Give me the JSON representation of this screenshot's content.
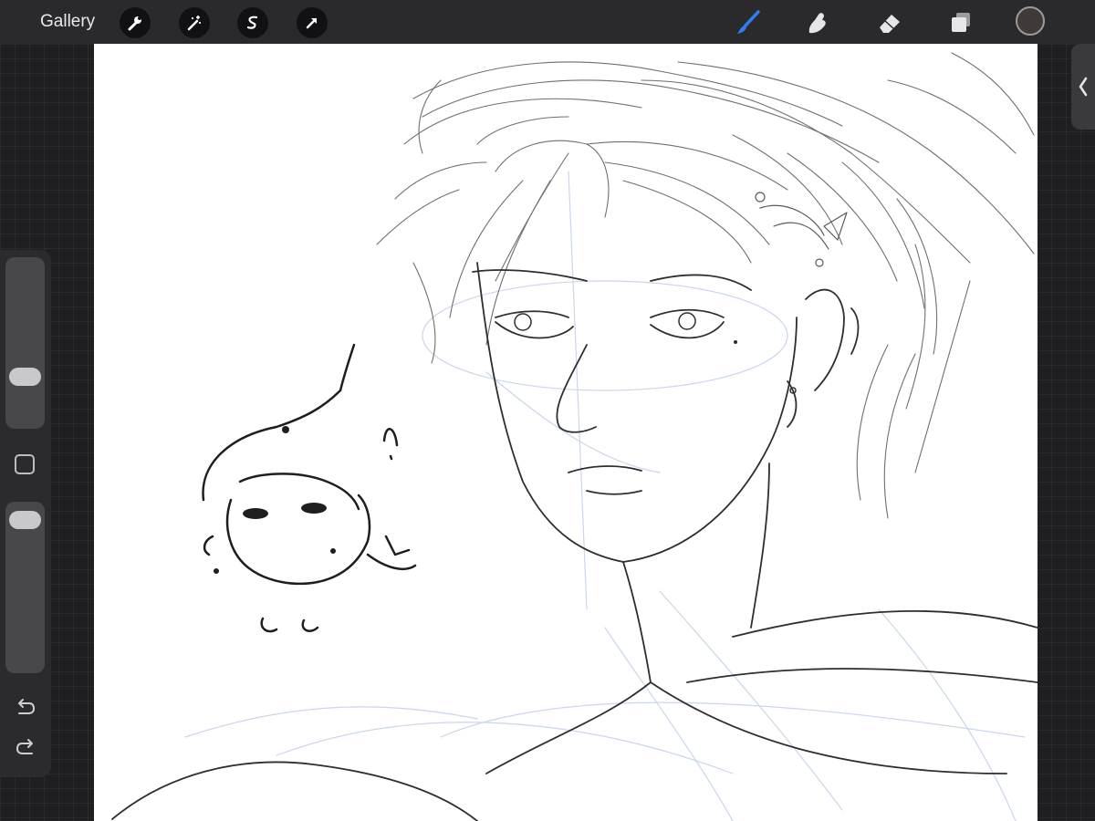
{
  "app": {
    "gallery_label": "Gallery"
  },
  "icons": {
    "left_tools": [
      "wrench-icon",
      "magic-wand-icon",
      "selection-icon",
      "transform-arrow-icon"
    ],
    "right_tools": [
      "brush-icon",
      "smudge-icon",
      "eraser-icon",
      "layers-icon"
    ]
  },
  "colors": {
    "active_tool": "#2f7cf6",
    "current_color": "#3f3a38",
    "canvas": "#ffffff"
  },
  "sidebar": {
    "brush_size": 0.27,
    "opacity": 0.96
  }
}
